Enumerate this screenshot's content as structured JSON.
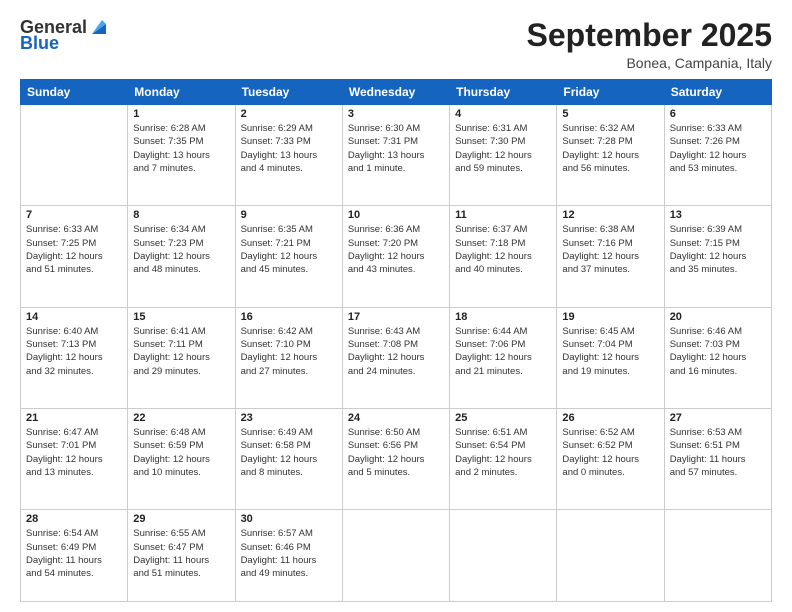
{
  "header": {
    "logo_general": "General",
    "logo_blue": "Blue",
    "month": "September 2025",
    "location": "Bonea, Campania, Italy"
  },
  "weekdays": [
    "Sunday",
    "Monday",
    "Tuesday",
    "Wednesday",
    "Thursday",
    "Friday",
    "Saturday"
  ],
  "weeks": [
    [
      {
        "day": "",
        "info": ""
      },
      {
        "day": "1",
        "info": "Sunrise: 6:28 AM\nSunset: 7:35 PM\nDaylight: 13 hours\nand 7 minutes."
      },
      {
        "day": "2",
        "info": "Sunrise: 6:29 AM\nSunset: 7:33 PM\nDaylight: 13 hours\nand 4 minutes."
      },
      {
        "day": "3",
        "info": "Sunrise: 6:30 AM\nSunset: 7:31 PM\nDaylight: 13 hours\nand 1 minute."
      },
      {
        "day": "4",
        "info": "Sunrise: 6:31 AM\nSunset: 7:30 PM\nDaylight: 12 hours\nand 59 minutes."
      },
      {
        "day": "5",
        "info": "Sunrise: 6:32 AM\nSunset: 7:28 PM\nDaylight: 12 hours\nand 56 minutes."
      },
      {
        "day": "6",
        "info": "Sunrise: 6:33 AM\nSunset: 7:26 PM\nDaylight: 12 hours\nand 53 minutes."
      }
    ],
    [
      {
        "day": "7",
        "info": "Sunrise: 6:33 AM\nSunset: 7:25 PM\nDaylight: 12 hours\nand 51 minutes."
      },
      {
        "day": "8",
        "info": "Sunrise: 6:34 AM\nSunset: 7:23 PM\nDaylight: 12 hours\nand 48 minutes."
      },
      {
        "day": "9",
        "info": "Sunrise: 6:35 AM\nSunset: 7:21 PM\nDaylight: 12 hours\nand 45 minutes."
      },
      {
        "day": "10",
        "info": "Sunrise: 6:36 AM\nSunset: 7:20 PM\nDaylight: 12 hours\nand 43 minutes."
      },
      {
        "day": "11",
        "info": "Sunrise: 6:37 AM\nSunset: 7:18 PM\nDaylight: 12 hours\nand 40 minutes."
      },
      {
        "day": "12",
        "info": "Sunrise: 6:38 AM\nSunset: 7:16 PM\nDaylight: 12 hours\nand 37 minutes."
      },
      {
        "day": "13",
        "info": "Sunrise: 6:39 AM\nSunset: 7:15 PM\nDaylight: 12 hours\nand 35 minutes."
      }
    ],
    [
      {
        "day": "14",
        "info": "Sunrise: 6:40 AM\nSunset: 7:13 PM\nDaylight: 12 hours\nand 32 minutes."
      },
      {
        "day": "15",
        "info": "Sunrise: 6:41 AM\nSunset: 7:11 PM\nDaylight: 12 hours\nand 29 minutes."
      },
      {
        "day": "16",
        "info": "Sunrise: 6:42 AM\nSunset: 7:10 PM\nDaylight: 12 hours\nand 27 minutes."
      },
      {
        "day": "17",
        "info": "Sunrise: 6:43 AM\nSunset: 7:08 PM\nDaylight: 12 hours\nand 24 minutes."
      },
      {
        "day": "18",
        "info": "Sunrise: 6:44 AM\nSunset: 7:06 PM\nDaylight: 12 hours\nand 21 minutes."
      },
      {
        "day": "19",
        "info": "Sunrise: 6:45 AM\nSunset: 7:04 PM\nDaylight: 12 hours\nand 19 minutes."
      },
      {
        "day": "20",
        "info": "Sunrise: 6:46 AM\nSunset: 7:03 PM\nDaylight: 12 hours\nand 16 minutes."
      }
    ],
    [
      {
        "day": "21",
        "info": "Sunrise: 6:47 AM\nSunset: 7:01 PM\nDaylight: 12 hours\nand 13 minutes."
      },
      {
        "day": "22",
        "info": "Sunrise: 6:48 AM\nSunset: 6:59 PM\nDaylight: 12 hours\nand 10 minutes."
      },
      {
        "day": "23",
        "info": "Sunrise: 6:49 AM\nSunset: 6:58 PM\nDaylight: 12 hours\nand 8 minutes."
      },
      {
        "day": "24",
        "info": "Sunrise: 6:50 AM\nSunset: 6:56 PM\nDaylight: 12 hours\nand 5 minutes."
      },
      {
        "day": "25",
        "info": "Sunrise: 6:51 AM\nSunset: 6:54 PM\nDaylight: 12 hours\nand 2 minutes."
      },
      {
        "day": "26",
        "info": "Sunrise: 6:52 AM\nSunset: 6:52 PM\nDaylight: 12 hours\nand 0 minutes."
      },
      {
        "day": "27",
        "info": "Sunrise: 6:53 AM\nSunset: 6:51 PM\nDaylight: 11 hours\nand 57 minutes."
      }
    ],
    [
      {
        "day": "28",
        "info": "Sunrise: 6:54 AM\nSunset: 6:49 PM\nDaylight: 11 hours\nand 54 minutes."
      },
      {
        "day": "29",
        "info": "Sunrise: 6:55 AM\nSunset: 6:47 PM\nDaylight: 11 hours\nand 51 minutes."
      },
      {
        "day": "30",
        "info": "Sunrise: 6:57 AM\nSunset: 6:46 PM\nDaylight: 11 hours\nand 49 minutes."
      },
      {
        "day": "",
        "info": ""
      },
      {
        "day": "",
        "info": ""
      },
      {
        "day": "",
        "info": ""
      },
      {
        "day": "",
        "info": ""
      }
    ]
  ]
}
